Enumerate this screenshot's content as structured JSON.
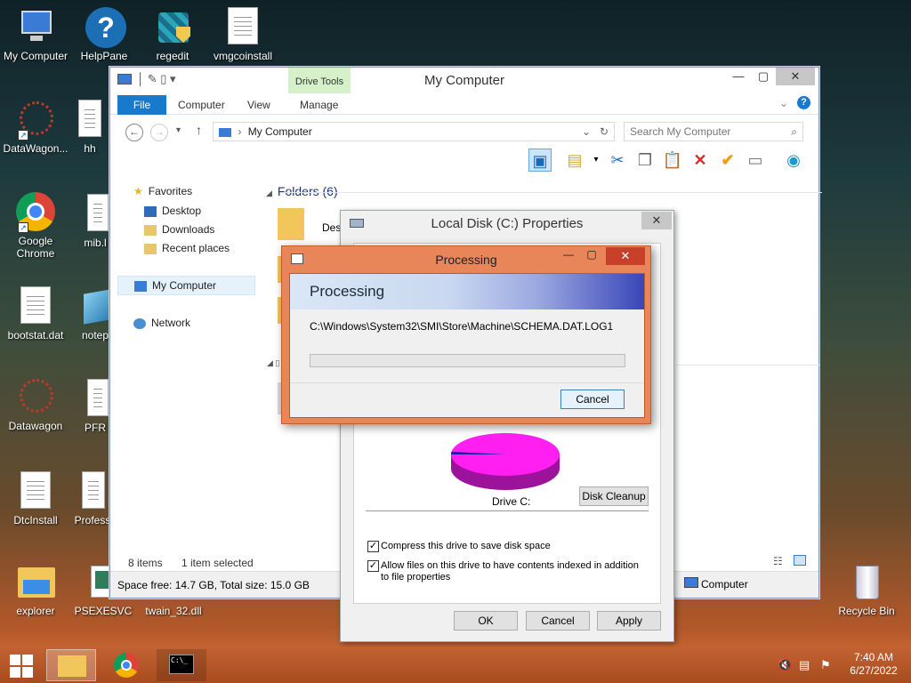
{
  "desktop": {
    "icons": [
      {
        "label": "My Computer"
      },
      {
        "label": "HelpPane"
      },
      {
        "label": "regedit"
      },
      {
        "label": "vmgcoinstall"
      },
      {
        "label": "DataWagon..."
      },
      {
        "label": "hh"
      },
      {
        "label": "Google Chrome"
      },
      {
        "label": "mib.l"
      },
      {
        "label": "bootstat.dat"
      },
      {
        "label": "notep"
      },
      {
        "label": "Datawagon"
      },
      {
        "label": "PFR"
      },
      {
        "label": "DtcInstall"
      },
      {
        "label": "Profess"
      },
      {
        "label": "explorer"
      },
      {
        "label": "PSEXESVC"
      },
      {
        "label": "twain_32.dll"
      },
      {
        "label": "Recycle Bin"
      }
    ]
  },
  "explorer": {
    "title": "My Computer",
    "context_tab_group": "Drive Tools",
    "tabs": [
      "File",
      "Computer",
      "View",
      "Manage"
    ],
    "address": "My Computer",
    "search_placeholder": "Search My Computer",
    "nav": {
      "favorites": "Favorites",
      "items": [
        "Desktop",
        "Downloads",
        "Recent places"
      ],
      "computer": "My Computer",
      "network": "Network"
    },
    "folders_header": "Folders (6)",
    "folder_partial": "Desl",
    "status": {
      "items": "8 items",
      "selected": "1 item selected"
    },
    "info": {
      "space": "Space free: 14.7 GB, Total size: 15.0 GB",
      "location": "Computer"
    }
  },
  "properties": {
    "title": "Local Disk (C:) Properties",
    "drive_label": "Drive C:",
    "disk_cleanup": "Disk Cleanup",
    "compress_label": "Compress this drive to save disk space",
    "index_label": "Allow files on this drive to have contents indexed in addition to file properties",
    "compress_checked": true,
    "index_checked": true,
    "buttons": {
      "ok": "OK",
      "cancel": "Cancel",
      "apply": "Apply"
    },
    "pie": {
      "used_color": "#1c1ca8",
      "free_color": "#ff1ff0",
      "used_fraction": 0.98
    }
  },
  "processing": {
    "title": "Processing",
    "heading": "Processing",
    "path": "C:\\Windows\\System32\\SMI\\Store\\Machine\\SCHEMA.DAT.LOG1",
    "cancel": "Cancel",
    "progress": 0
  },
  "taskbar": {
    "time": "7:40 AM",
    "date": "6/27/2022"
  },
  "colors": {
    "accent": "#1979ca",
    "taskbar": "#b3562a"
  }
}
